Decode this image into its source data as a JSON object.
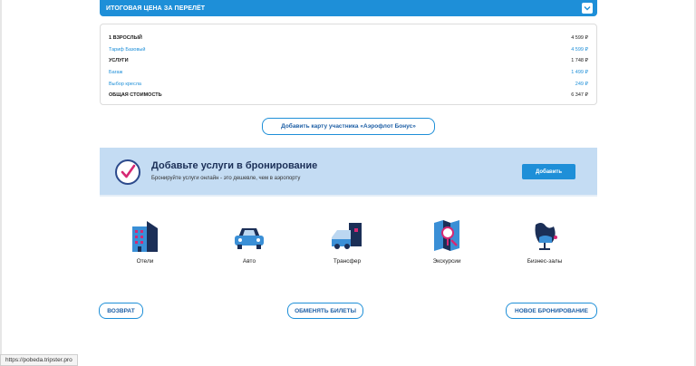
{
  "price_header": {
    "title": "ИТОГОВАЯ ЦЕНА ЗА ПЕРЕЛЁТ"
  },
  "price_rows": [
    {
      "label": "1 ВЗРОСЛЫЙ",
      "value": "4 599 ₽",
      "kind": "main"
    },
    {
      "label": "Тариф Базовый",
      "value": "4 599 ₽",
      "kind": "sub"
    },
    {
      "label": "УСЛУГИ",
      "value": "1 748 ₽",
      "kind": "main"
    },
    {
      "label": "Багаж",
      "value": "1 499 ₽",
      "kind": "sub"
    },
    {
      "label": "Выбор кресла",
      "value": "249 ₽",
      "kind": "sub"
    },
    {
      "label": "ОБЩАЯ СТОИМОСТЬ",
      "value": "6 347 ₽",
      "kind": "main"
    }
  ],
  "bonus_button": "Добавить карту участника «Аэрофлот Бонус»",
  "services_banner": {
    "title": "Добавьте услуги в бронирование",
    "subtitle": "Бронируйте услуги онлайн - это дешевле, чем в аэропорту",
    "add_button": "Добавить"
  },
  "services": [
    {
      "label": "Отели",
      "icon": "hotel-icon"
    },
    {
      "label": "Авто",
      "icon": "car-icon"
    },
    {
      "label": "Трансфер",
      "icon": "transfer-van-icon"
    },
    {
      "label": "Экскурсии",
      "icon": "map-pin-icon"
    },
    {
      "label": "Бизнес-залы",
      "icon": "lounge-chair-icon"
    }
  ],
  "bottom_buttons": {
    "refund": "ВОЗВРАТ",
    "exchange": "ОБМЕНЯТЬ БИЛЕТЫ",
    "new_booking": "НОВОЕ БРОНИРОВАНИЕ"
  },
  "status_bar": {
    "url": "https://pobeda.tripster.pro"
  },
  "colors": {
    "accent": "#1e8fd8",
    "banner_bg": "#c4dcf3",
    "navy": "#1b2f57"
  }
}
